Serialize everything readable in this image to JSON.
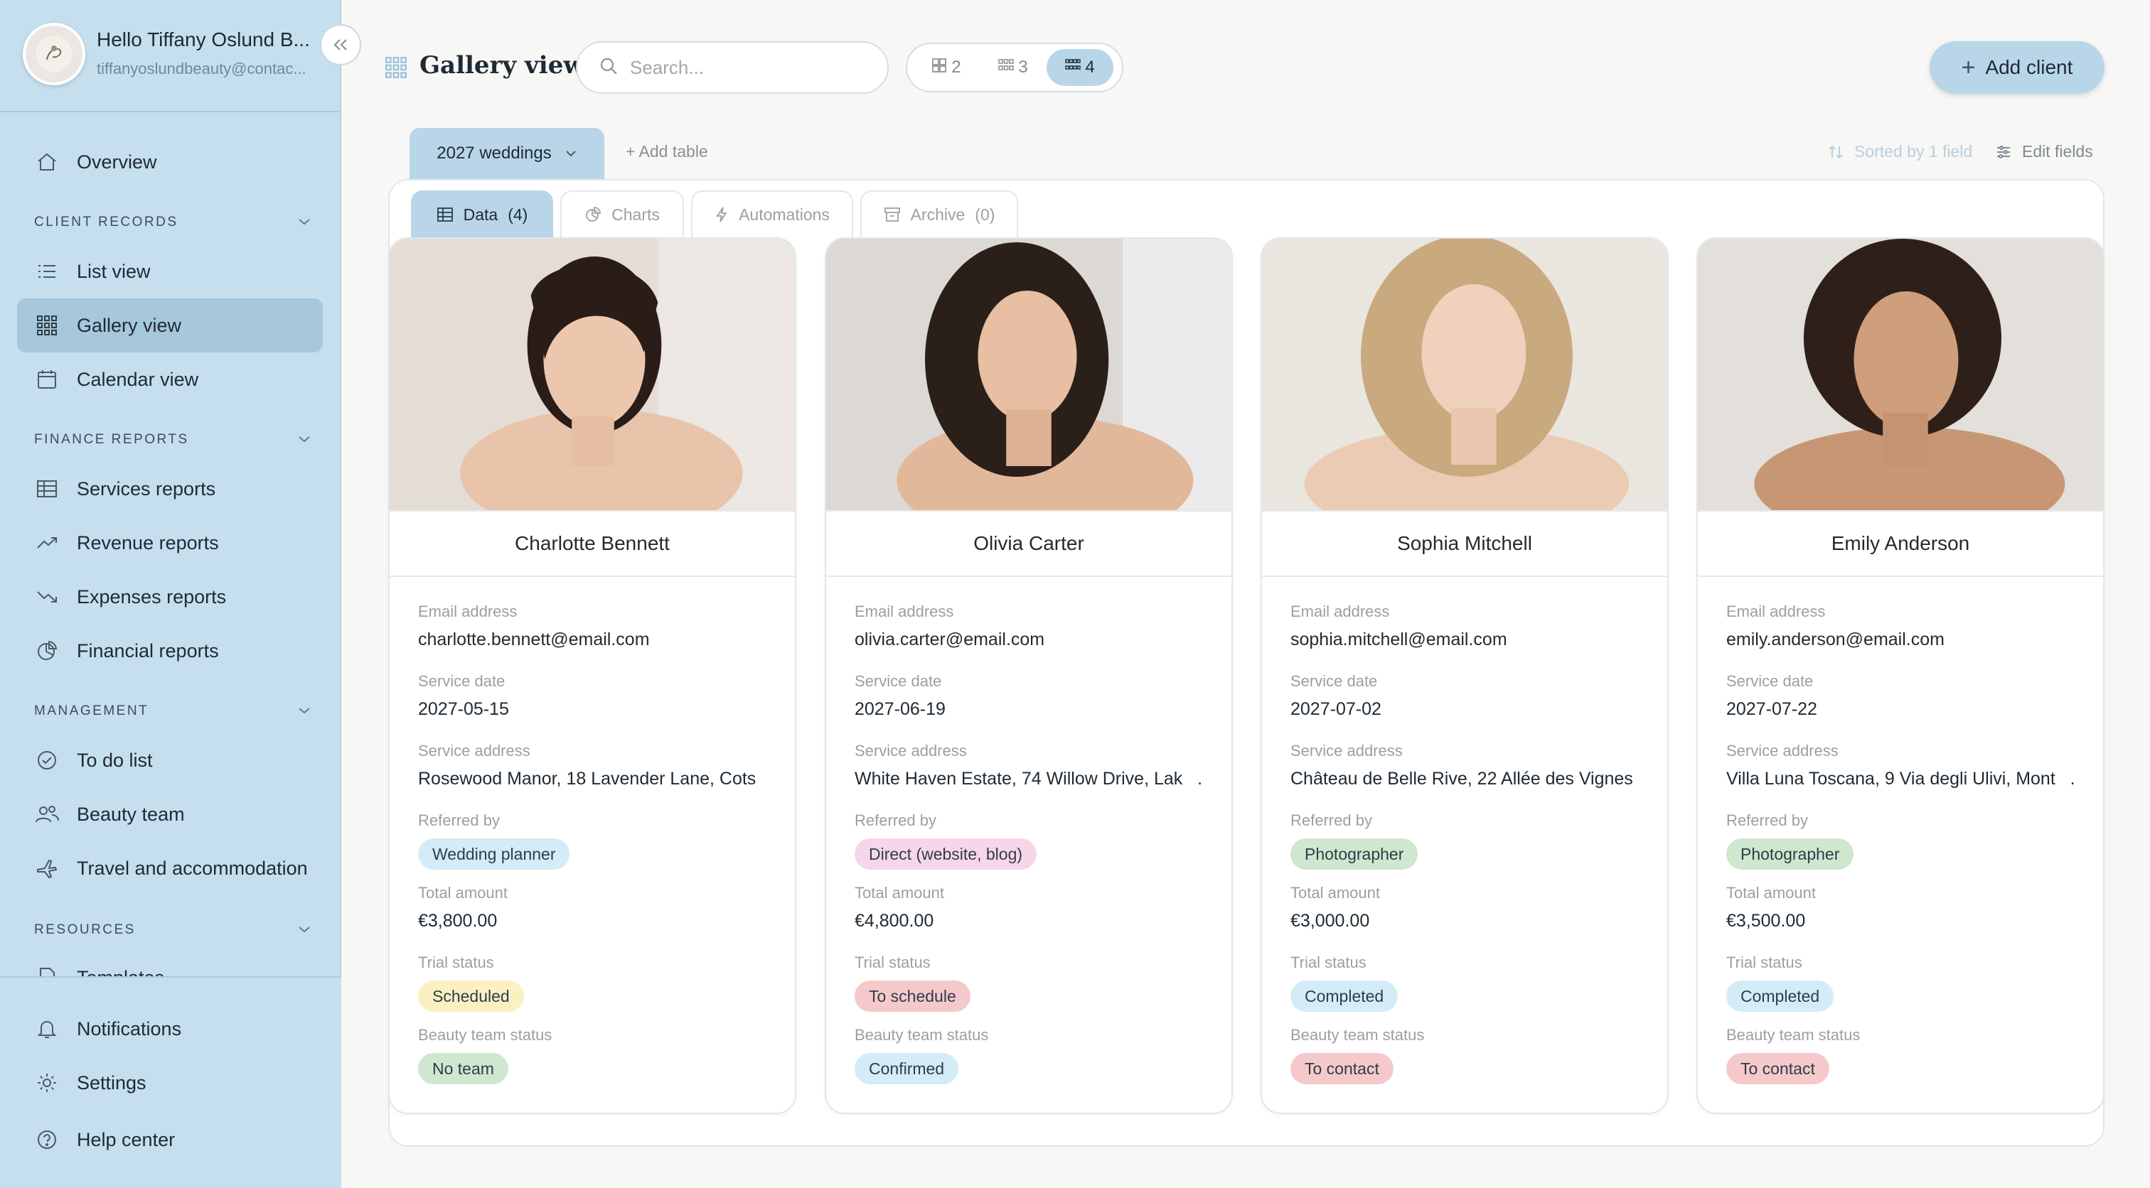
{
  "profile": {
    "name": "Hello Tiffany Oslund B...",
    "email": "tiffanyoslundbeauty@contac..."
  },
  "sidebar": {
    "overview": "Overview",
    "sections": {
      "client_records": "CLIENT RECORDS",
      "finance_reports": "FINANCE REPORTS",
      "management": "MANAGEMENT",
      "resources": "RESOURCES"
    },
    "items": {
      "list_view": "List view",
      "gallery_view": "Gallery view",
      "calendar_view": "Calendar view",
      "services_reports": "Services reports",
      "revenue_reports": "Revenue reports",
      "expenses_reports": "Expenses reports",
      "financial_reports": "Financial reports",
      "to_do_list": "To do list",
      "beauty_team": "Beauty team",
      "travel": "Travel and accommodation",
      "templates": "Templates"
    },
    "bottom": {
      "notifications": "Notifications",
      "settings": "Settings",
      "help_center": "Help center"
    }
  },
  "header": {
    "title": "Gallery view",
    "search_placeholder": "Search...",
    "columns": [
      "2",
      "3",
      "4"
    ],
    "active_columns": "4",
    "add_client": "Add client"
  },
  "tables": {
    "active": "2027 weddings",
    "add_table": "+ Add table",
    "sorted": "Sorted by 1 field",
    "edit_fields": "Edit fields"
  },
  "subtabs": {
    "data": "Data",
    "data_count": "(4)",
    "charts": "Charts",
    "automations": "Automations",
    "archive": "Archive",
    "archive_count": "(0)"
  },
  "labels": {
    "email": "Email address",
    "service_date": "Service date",
    "service_address": "Service address",
    "referred_by": "Referred by",
    "total_amount": "Total amount",
    "trial_status": "Trial status",
    "team_status": "Beauty team status"
  },
  "cards": [
    {
      "name": "Charlotte Bennett",
      "email": "charlotte.bennett@email.com",
      "date": "2027-05-15",
      "address": "Rosewood Manor, 18 Lavender Lane, Cots",
      "referred": "Wedding planner",
      "amount": "€3,800.00",
      "trial": "Scheduled",
      "team": "No team"
    },
    {
      "name": "Olivia Carter",
      "email": "olivia.carter@email.com",
      "date": "2027-06-19",
      "address": "White Haven Estate, 74 Willow Drive, Lak",
      "referred": "Direct (website, blog)",
      "amount": "€4,800.00",
      "trial": "To schedule",
      "team": "Confirmed"
    },
    {
      "name": "Sophia Mitchell",
      "email": "sophia.mitchell@email.com",
      "date": "2027-07-02",
      "address": "Château de Belle Rive, 22 Allée des Vignes",
      "referred": "Photographer",
      "amount": "€3,000.00",
      "trial": "Completed",
      "team": "To contact"
    },
    {
      "name": "Emily Anderson",
      "email": "emily.anderson@email.com",
      "date": "2027-07-22",
      "address": "Villa Luna Toscana, 9 Via degli Ulivi, Mont",
      "referred": "Photographer",
      "amount": "€3,500.00",
      "trial": "Completed",
      "team": "To contact"
    }
  ],
  "ellipsis": "...",
  "colors": {
    "sidebar_bg": "#c5dfee",
    "accent": "#b9d6e9",
    "badge_blue": "#d4ecf7",
    "badge_pink": "#f7d6ea",
    "badge_green": "#cfe7cf",
    "badge_yellow": "#fbf0c2",
    "badge_red": "#f5c9cb"
  }
}
